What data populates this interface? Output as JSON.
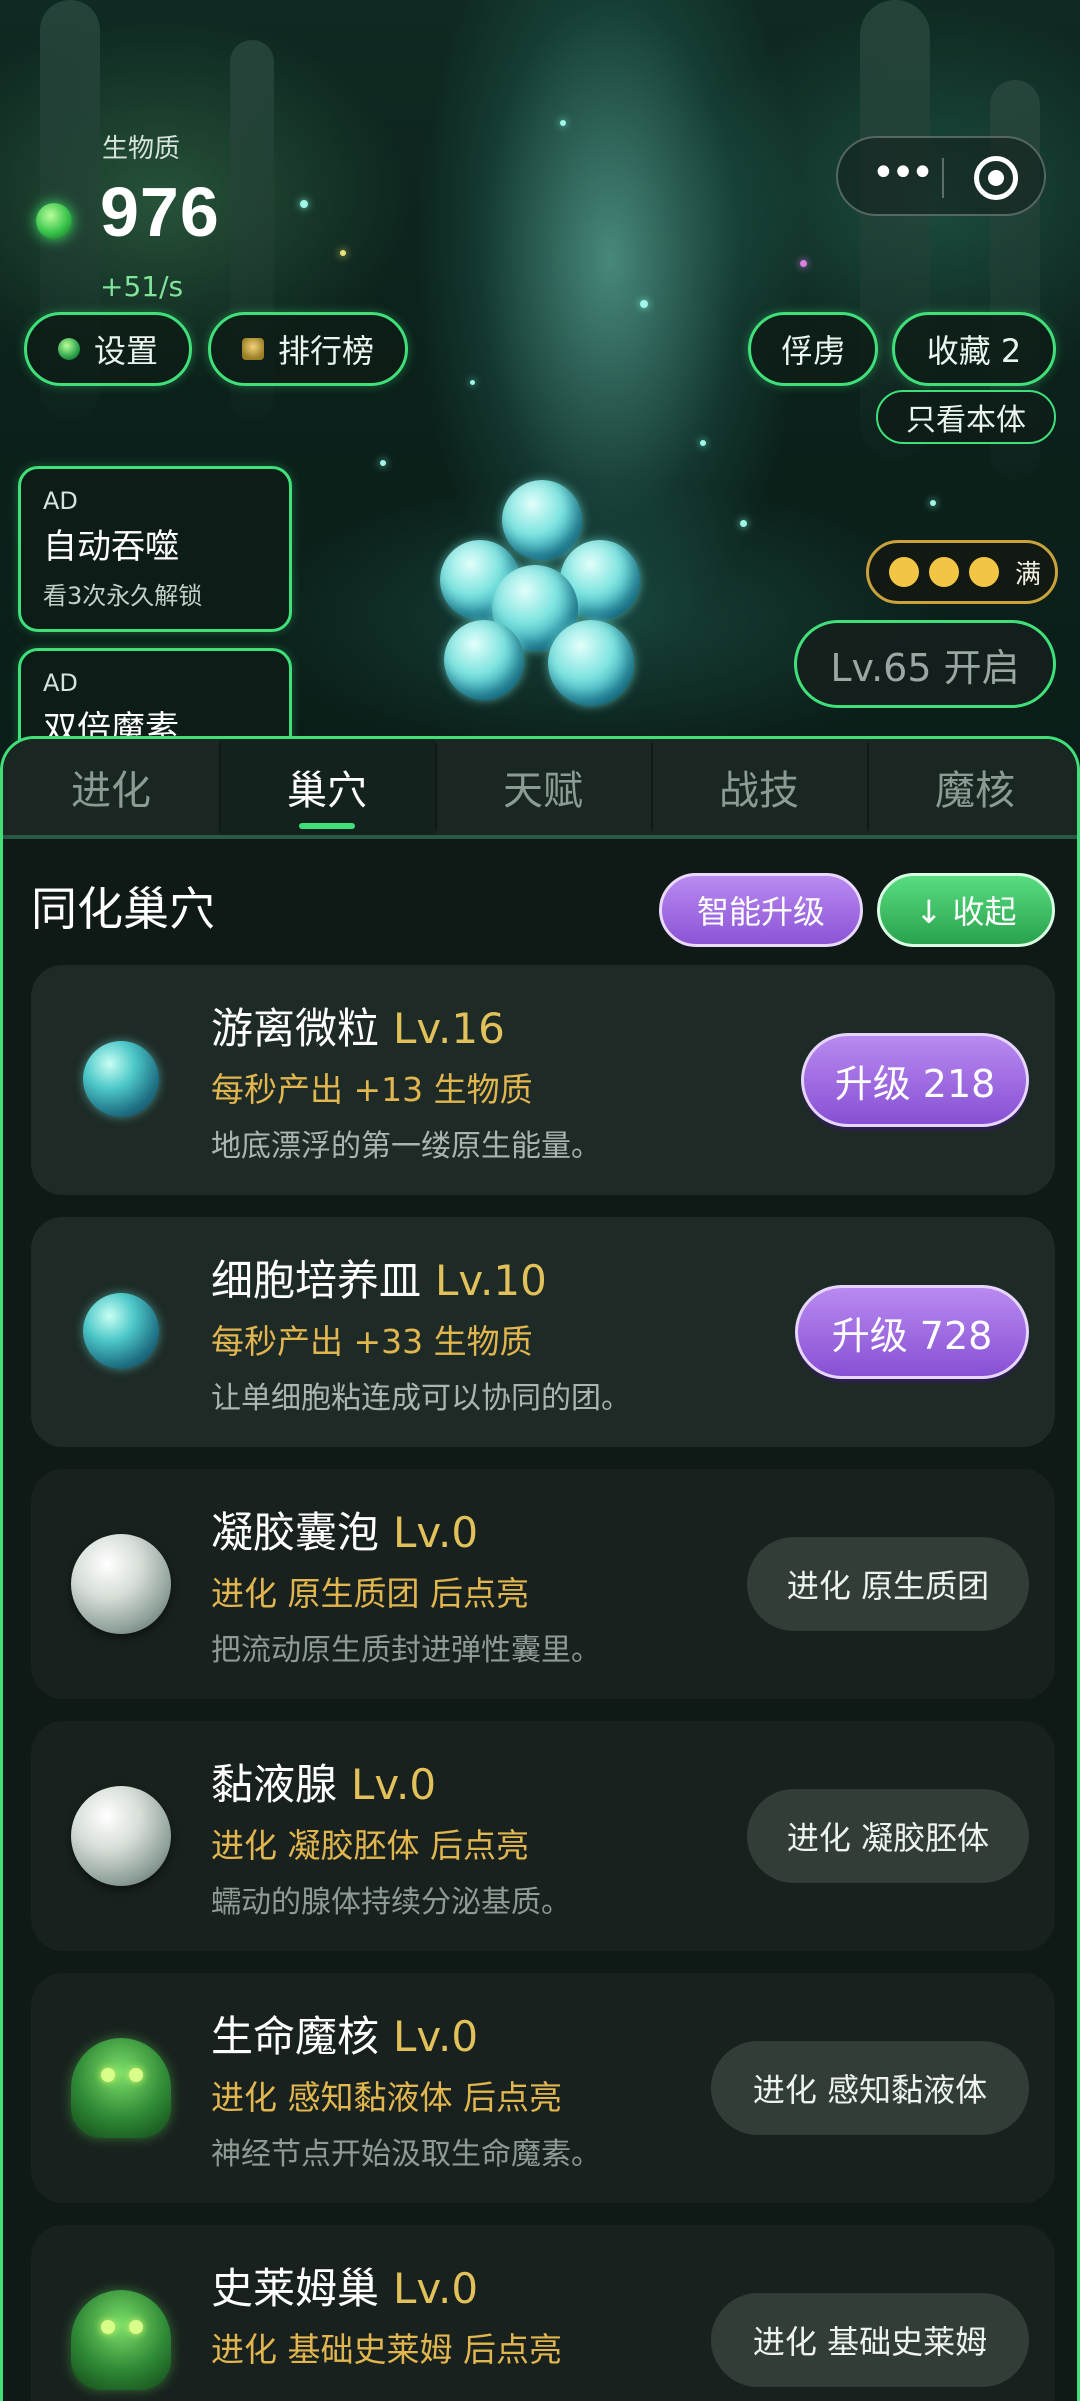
{
  "hud": {
    "resource_label": "生物质",
    "resource_value": "976",
    "resource_rate": "+51/s",
    "settings_label": "设置",
    "leaderboard_label": "排行榜",
    "captives_label": "俘虏",
    "favorites_label": "收藏 2",
    "only_self_label": "只看本体"
  },
  "ads": [
    {
      "tag": "AD",
      "title": "自动吞噬",
      "subtitle": "看3次永久解锁"
    },
    {
      "tag": "AD",
      "title": "双倍魔素",
      "subtitle": ""
    }
  ],
  "status": {
    "charges_total": 3,
    "charges_filled": 3,
    "full_label": "满",
    "level_unlock_label": "Lv.65 开启"
  },
  "tabs": [
    {
      "label": "进化",
      "active": false
    },
    {
      "label": "巢穴",
      "active": true
    },
    {
      "label": "天赋",
      "active": false
    },
    {
      "label": "战技",
      "active": false
    },
    {
      "label": "魔核",
      "active": false
    }
  ],
  "section": {
    "title": "同化巢穴",
    "smart_upgrade_label": "智能升级",
    "collapse_label": "↓ 收起"
  },
  "nests": [
    {
      "name": "游离微粒",
      "level": "Lv.16",
      "production": "每秒产出 +13 生物质",
      "description": "地底漂浮的第一缕原生能量。",
      "action": "升级 218",
      "state": "upgrade",
      "art": "crystal"
    },
    {
      "name": "细胞培养皿",
      "level": "Lv.10",
      "production": "每秒产出 +33 生物质",
      "description": "让单细胞粘连成可以协同的团。",
      "action": "升级 728",
      "state": "upgrade",
      "art": "crystal"
    },
    {
      "name": "凝胶囊泡",
      "level": "Lv.0",
      "production": "进化 原生质团 后点亮",
      "description": "把流动原生质封进弹性囊里。",
      "action": "进化 原生质团",
      "state": "locked",
      "art": "pearl"
    },
    {
      "name": "黏液腺",
      "level": "Lv.0",
      "production": "进化 凝胶胚体 后点亮",
      "description": "蠕动的腺体持续分泌基质。",
      "action": "进化 凝胶胚体",
      "state": "locked",
      "art": "pearl"
    },
    {
      "name": "生命魔核",
      "level": "Lv.0",
      "production": "进化 感知黏液体 后点亮",
      "description": "神经节点开始汲取生命魔素。",
      "action": "进化 感知黏液体",
      "state": "locked",
      "art": "ghost"
    },
    {
      "name": "史莱姆巢",
      "level": "Lv.0",
      "production": "进化 基础史莱姆 后点亮",
      "description": "",
      "action": "进化 基础史莱姆",
      "state": "locked",
      "art": "ghost"
    }
  ],
  "colors": {
    "accent_green": "#3fe07a",
    "upgrade_purple": "#8b54d6",
    "gold_text": "#e2b64f",
    "panel_bg": "#0f1916"
  }
}
